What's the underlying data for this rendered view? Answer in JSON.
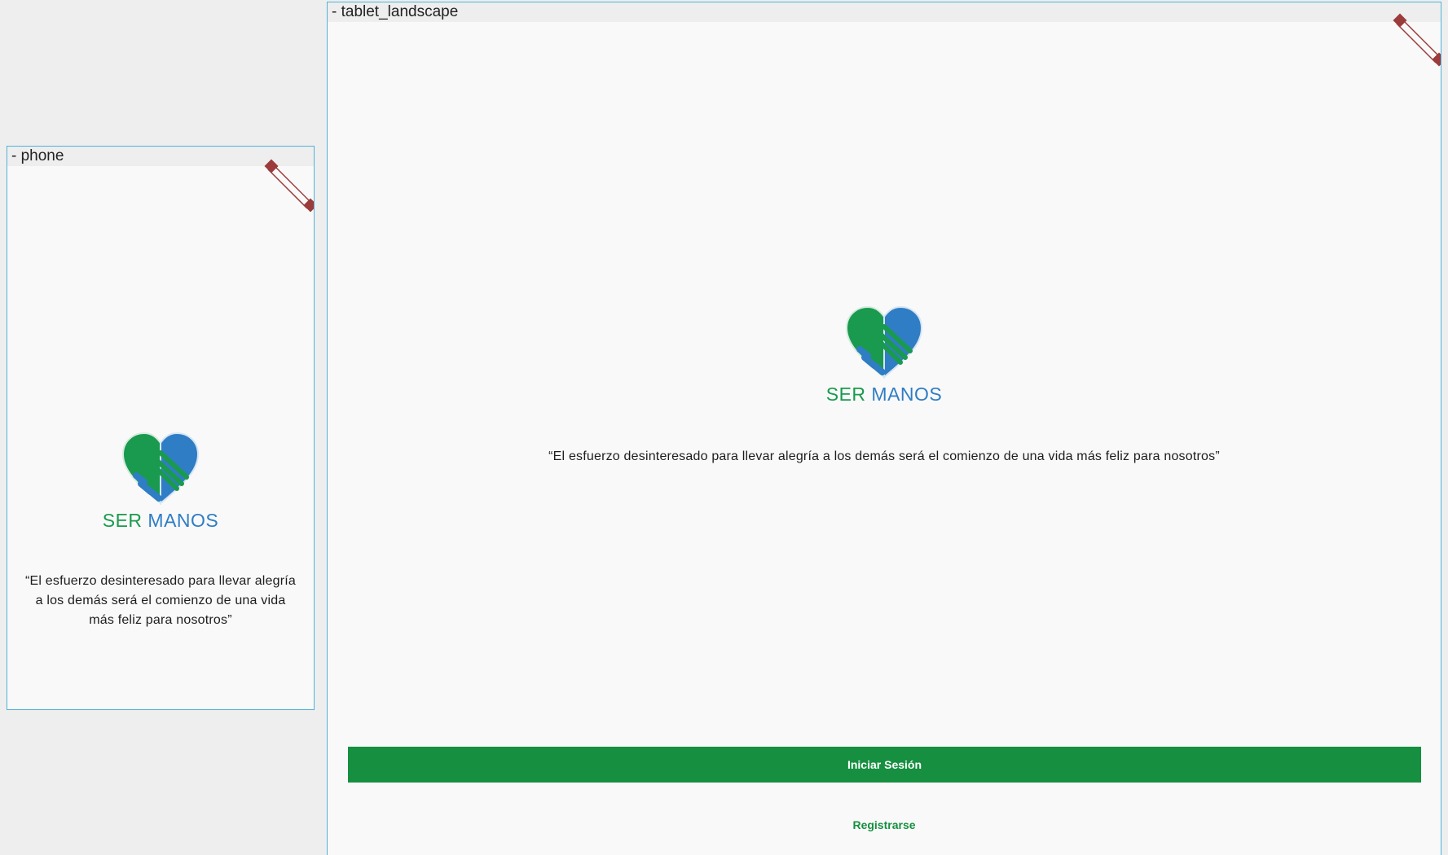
{
  "frames": {
    "phone": {
      "label": "- phone"
    },
    "tablet": {
      "label": "- tablet_landscape"
    }
  },
  "brand": {
    "ser": "SER",
    "manos": "MANOS",
    "green": "#1a9a4e",
    "blue": "#2f7dc4"
  },
  "quote": "“El esfuerzo desinteresado para llevar alegría a los demás será el comienzo de una vida más feliz para nosotros”",
  "actions": {
    "login_label": "Iniciar Sesión",
    "register_label": "Registrarse"
  },
  "colors": {
    "primary": "#168f40",
    "frame_border": "#4fb3d9",
    "debug_banner": "#9b3b3b"
  }
}
